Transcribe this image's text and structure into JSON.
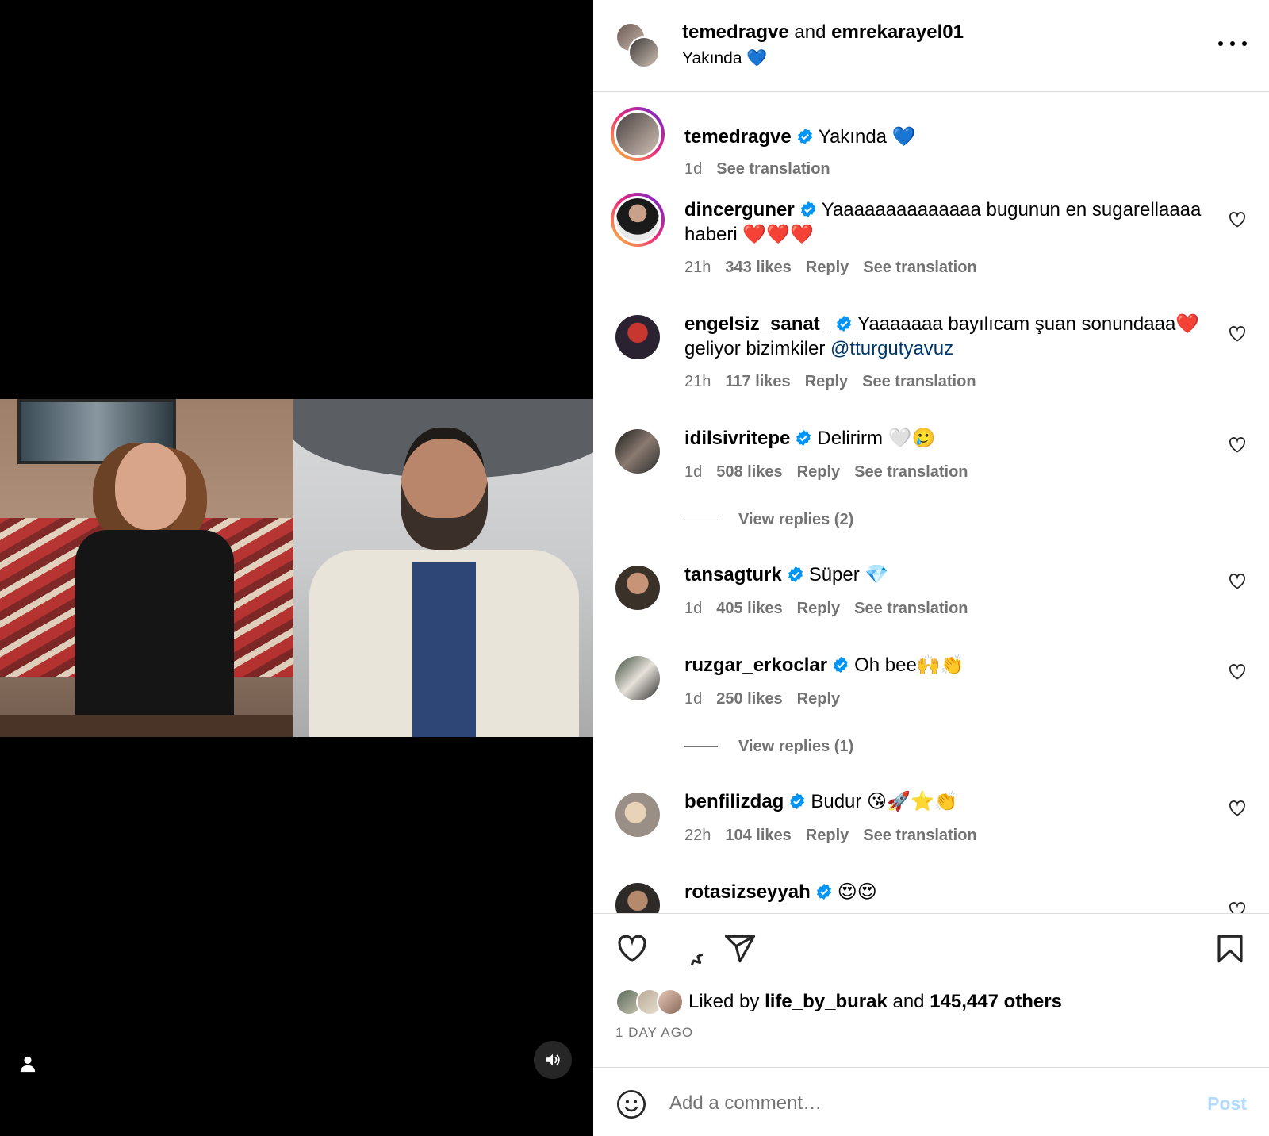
{
  "header": {
    "user1": "temedragve",
    "joiner": "and",
    "user2": "emrekarayel01",
    "subtitle": "Yakında 💙"
  },
  "comments": [
    {
      "user": "temedragve",
      "text": "Yakında 💙",
      "time": "1d",
      "likes": "",
      "reply": "",
      "translation": "See translation"
    },
    {
      "user": "dincerguner",
      "text": "Yaaaaaaaaaaaaaa bugunun en sugarellaaaa haberi ❤️❤️❤️",
      "time": "21h",
      "likes": "343 likes",
      "reply": "Reply",
      "translation": "See translation"
    },
    {
      "user": "engelsiz_sanat_",
      "text": "Yaaaaaaa bayılıcam şuan sonundaaa❤️ geliyor bizimkiler",
      "mention": "@tturgutyavuz",
      "time": "21h",
      "likes": "117 likes",
      "reply": "Reply",
      "translation": "See translation"
    },
    {
      "user": "idilsivritepe",
      "text": "Delirirm 🤍🥲",
      "time": "1d",
      "likes": "508 likes",
      "reply": "Reply",
      "translation": "See translation",
      "replies": "View replies (2)"
    },
    {
      "user": "tansagturk",
      "text": "Süper 💎",
      "time": "1d",
      "likes": "405 likes",
      "reply": "Reply",
      "translation": "See translation"
    },
    {
      "user": "ruzgar_erkoclar",
      "text": "Oh bee🙌👏",
      "time": "1d",
      "likes": "250 likes",
      "reply": "Reply",
      "translation": "",
      "replies": "View replies (1)"
    },
    {
      "user": "benfilizdag",
      "text": "Budur 😘🚀⭐👏",
      "time": "22h",
      "likes": "104 likes",
      "reply": "Reply",
      "translation": "See translation"
    },
    {
      "user": "rotasizseyyah",
      "text": "😍😍"
    }
  ],
  "liked": {
    "prefix": "Liked by",
    "user": "life_by_burak",
    "joiner": "and",
    "others": "145,447 others"
  },
  "date": "1 DAY AGO",
  "composer": {
    "placeholder": "Add a comment…",
    "post_label": "Post"
  },
  "colors": {
    "verified": "#0095f6",
    "link": "#00376b",
    "muted": "#737373",
    "post_disabled": "#b3dbff"
  }
}
